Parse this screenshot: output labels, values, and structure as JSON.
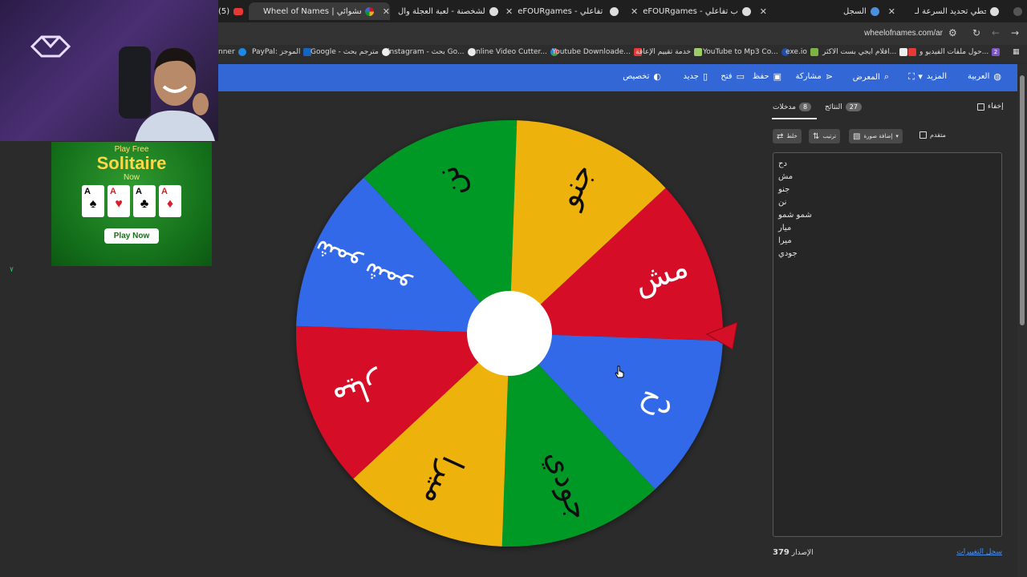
{
  "browser": {
    "tabs": [
      {
        "title": "(5)",
        "active": false
      },
      {
        "title": "Wheel of Names | اسم العشوائي",
        "active": true
      },
      {
        "title": "دوامة الشخصنة - لعبة العجلة وال",
        "active": false
      },
      {
        "title": "eFOURgames - ع ألعاب تفاعلي",
        "active": false
      },
      {
        "title": "eFOURgames - ع ألعاب تفاعلي",
        "active": false
      },
      {
        "title": "السجل",
        "active": false
      },
      {
        "title": "تحطي تحديد السرعة لـ STC",
        "active": false
      }
    ],
    "url": "wheelofnames.com/ar",
    "bookmarks": [
      "nner",
      "PayPal: الموجز",
      "Google - مترجم بحث",
      "instagram - بحث Go...",
      "Online Video Cutter...",
      "Youtube Downloade...",
      "خدمة تقييم الإعاقة",
      "YouTube to Mp3 Co...",
      "exe.io",
      "افلام ايجي بست الاكثر...",
      "حول ملفات الفيديو و...",
      "2"
    ]
  },
  "ad": {
    "line1": "Play Free",
    "line2": "Solitaire",
    "line3": "Now",
    "button": "Play Now",
    "cards": [
      {
        "rank": "A",
        "suit": "♠",
        "color": "#111111"
      },
      {
        "rank": "A",
        "suit": "♥",
        "color": "#d81e2a"
      },
      {
        "rank": "A",
        "suit": "♣",
        "color": "#111111"
      },
      {
        "rank": "A",
        "suit": "♦",
        "color": "#d81e2a"
      }
    ]
  },
  "left_mark": "٧",
  "toolbar": {
    "items": [
      {
        "label": "العربية",
        "icon": "globe-icon"
      },
      {
        "label": "المزيد",
        "icon": "caret-down-icon"
      },
      {
        "label": "",
        "icon": "fullscreen-icon"
      },
      {
        "label": "المعرض",
        "icon": "search-icon"
      },
      {
        "label": "مشاركة",
        "icon": "share-icon"
      },
      {
        "label": "حفظ",
        "icon": "save-icon"
      },
      {
        "label": "فتح",
        "icon": "folder-icon"
      },
      {
        "label": "جديد",
        "icon": "file-icon"
      },
      {
        "label": "تخصيص",
        "icon": "palette-icon"
      }
    ]
  },
  "wheel": {
    "segments": [
      {
        "label": "دح",
        "color": "#3369e8",
        "text_color": "#ffffff"
      },
      {
        "label": "جودي",
        "color": "#009925",
        "text_color": "#111111"
      },
      {
        "label": "ميرا",
        "color": "#eeb211",
        "text_color": "#111111"
      },
      {
        "label": "ميار",
        "color": "#d50f25",
        "text_color": "#ffffff"
      },
      {
        "label": "شمو شمو",
        "color": "#3369e8",
        "text_color": "#ffffff"
      },
      {
        "label": "نن",
        "color": "#009925",
        "text_color": "#111111"
      },
      {
        "label": "جنو",
        "color": "#eeb211",
        "text_color": "#111111"
      },
      {
        "label": "مش",
        "color": "#d50f25",
        "text_color": "#ffffff"
      }
    ],
    "pointer_color": "#d50f25"
  },
  "panel": {
    "hide_label": "إخفاء",
    "results_tab": {
      "label": "النتائج",
      "count": "27"
    },
    "entries_tab": {
      "label": "مدخلات",
      "count": "8"
    },
    "shuffle_label": "خلط",
    "sort_label": "ترتيب",
    "add_image_label": "إضافة صورة",
    "advanced_label": "متقدم",
    "entries": [
      "دح",
      "مش",
      "جنو",
      "نن",
      "شمو شمو",
      "ميار",
      "ميرا",
      "جودي"
    ],
    "version_label": "الإصدار",
    "version_number": "379",
    "changelog_label": "سجل التغييرات"
  }
}
